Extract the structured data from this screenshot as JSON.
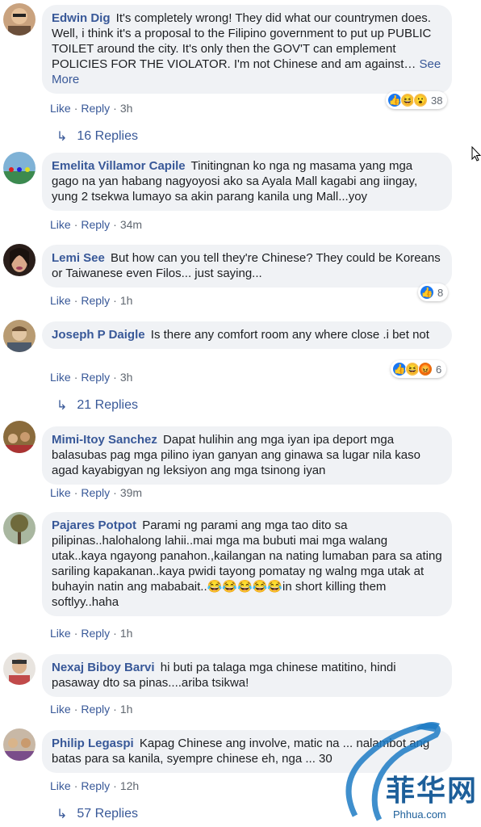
{
  "comments": [
    {
      "author": "Edwin Dig",
      "text": "It's completely wrong! They did what our countrymen does. Well, i think it's a proposal to the Filipino government to put up PUBLIC TOILET around the city. It's only then the GOV'T can emplement POLICIES FOR THE VIOLATOR. I'm not Chinese and am against…",
      "see_more": "See More",
      "like": "Like",
      "reply": "Reply",
      "time": "3h",
      "reaction_count": "38",
      "replies": "16 Replies"
    },
    {
      "author": "Emelita Villamor Capile",
      "text": "Tinitingnan ko nga ng masama yang mga gago na yan habang nagyoyosi ako sa Ayala Mall kagabi ang iingay, yung 2 tsekwa lumayo sa akin parang kanila ung Mall...yoy",
      "like": "Like",
      "reply": "Reply",
      "time": "34m"
    },
    {
      "author": "Lemi See",
      "text": "But how can you tell they're Chinese? They could be Koreans or Taiwanese even Filos... just saying...",
      "like": "Like",
      "reply": "Reply",
      "time": "1h",
      "reaction_count": "8"
    },
    {
      "author": "Joseph P Daigle",
      "text": "Is there any comfort room any where close .i bet not",
      "like": "Like",
      "reply": "Reply",
      "time": "3h",
      "reaction_count": "6",
      "replies": "21 Replies"
    },
    {
      "author": "Mimi-Itoy Sanchez",
      "text": "Dapat hulihin ang mga iyan ipa deport mga balasubas pag mga pilino iyan ganyan ang ginawa sa lugar nila kaso agad kayabigyan ng leksiyon ang mga tsinong iyan",
      "like": "Like",
      "reply": "Reply",
      "time": "39m"
    },
    {
      "author": "Pajares Potpot",
      "text": "Parami ng parami ang mga tao dito sa pilipinas..halohalong lahii..mai mga ma bubuti mai mga walang utak..kaya ngayong panahon.,kailangan na nating lumaban para sa ating sariling kapakanan..kaya pwidi tayong pomatay ng walng mga utak at buhayin natin ang mababait..😂😂😂😂😂in short killing them softlyy..haha",
      "like": "Like",
      "reply": "Reply",
      "time": "1h"
    },
    {
      "author": "Nexaj Biboy Barvi",
      "text": "hi buti pa talaga mga chinese matitino, hindi pasaway dto sa pinas....ariba tsikwa!",
      "like": "Like",
      "reply": "Reply",
      "time": "1h"
    },
    {
      "author": "Philip Legaspi",
      "text": "Kapag Chinese ang involve, matic na ... nalambot ang batas para sa kanila, syempre chinese eh, nga ... 30",
      "like": "Like",
      "reply": "Reply",
      "time": "12h",
      "replies": "57 Replies"
    }
  ],
  "watermark": {
    "text": "菲华网",
    "url": "Phhua.com"
  },
  "colors": {
    "link": "#385898",
    "bubble": "#f0f2f5",
    "like_blue": "#1877f2"
  }
}
